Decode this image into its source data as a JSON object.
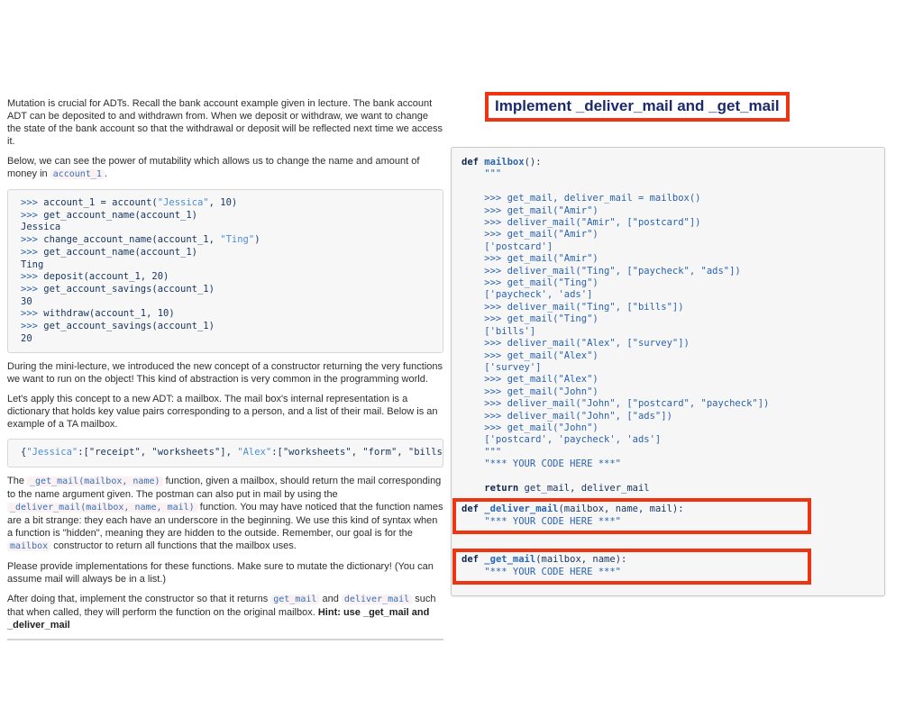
{
  "colors": {
    "highlight_red": "#ee3512",
    "title_navy": "#1b2a6b",
    "code_navy": "#16335f",
    "code_blue": "#2a62ad",
    "code_string_blue": "#4a8ed6",
    "inline_code_bg": "#fcf1f2",
    "panel_bg": "#f6f6f6"
  },
  "title_box": {
    "label": "Implement _deliver_mail and _get_mail"
  },
  "left_column": {
    "paragraphs": [
      {
        "name": "intro-mutation",
        "segments": [
          {
            "c": "t",
            "t": "Mutation is crucial for ADTs. Recall the bank account example given in lecture. The bank account ADT can be deposited to and withdrawn from. When we deposit or withdraw, we want to change the state of the bank account so that the withdrawal or deposit will be reflected next time we access it."
          }
        ]
      },
      {
        "name": "below-mutability",
        "segments": [
          {
            "c": "t",
            "t": "Below, we can see the power of mutability which allows us to change the name and amount of money in "
          },
          {
            "c": "c",
            "t": "account_1"
          },
          {
            "c": "t",
            "t": "."
          }
        ]
      },
      {
        "name": "mini-lecture",
        "segments": [
          {
            "c": "t",
            "t": "During the mini-lecture, we introduced the new concept of a constructor returning the very functions we want to run on the object! This kind of abstraction is very common in the programming world."
          }
        ]
      },
      {
        "name": "apply-concept",
        "segments": [
          {
            "c": "t",
            "t": "Let's apply this concept to a new ADT: a mailbox. The mail box's internal representation is a dictionary that holds key value pairs corresponding to a person, and a list of their mail. Below is an example of a TA mailbox."
          }
        ]
      },
      {
        "name": "get-mail-description",
        "segments": [
          {
            "c": "t",
            "t": "The "
          },
          {
            "c": "c",
            "t": "_get_mail(mailbox, name)"
          },
          {
            "c": "t",
            "t": " function, given a mailbox, should return the mail corresponding to the name argument given. The postman can also put in mail by using the "
          },
          {
            "c": "c",
            "t": "_deliver_mail(mailbox, name, mail)"
          },
          {
            "c": "t",
            "t": " function. You may have noticed that the function names are a bit strange: they each have an underscore in the beginning. We use this kind of syntax when a function is \"hidden\", meaning they are hidden to the outside. Remember, our goal is for the "
          },
          {
            "c": "c",
            "t": "mailbox"
          },
          {
            "c": "t",
            "t": " constructor to return all functions that the mailbox uses."
          }
        ]
      },
      {
        "name": "provide-implementations",
        "segments": [
          {
            "c": "t",
            "t": "Please provide implementations for these functions. Make sure to mutate the dictionary! (You can assume mail will always be in a list.)"
          }
        ]
      },
      {
        "name": "after-doing-that",
        "segments": [
          {
            "c": "t",
            "t": "After doing that, implement the constructor so that it returns "
          },
          {
            "c": "c",
            "t": "get_mail"
          },
          {
            "c": "t",
            "t": " and "
          },
          {
            "c": "c",
            "t": "deliver_mail"
          },
          {
            "c": "t",
            "t": " such that when called, they will perform the function on the original mailbox. "
          },
          {
            "c": "b",
            "t": "Hint: use _get_mail and _deliver_mail"
          }
        ]
      }
    ],
    "console_block": {
      "lines": [
        [
          {
            "c": "b",
            "t": ">>> "
          },
          {
            "c": "p",
            "t": "account_1 = account("
          },
          {
            "c": "s",
            "t": "\"Jessica\""
          },
          {
            "c": "p",
            "t": ", 10)"
          }
        ],
        [
          {
            "c": "b",
            "t": ">>> "
          },
          {
            "c": "p",
            "t": "get_account_name(account_1)"
          }
        ],
        [
          {
            "c": "p",
            "t": "Jessica"
          }
        ],
        [
          {
            "c": "b",
            "t": ">>> "
          },
          {
            "c": "p",
            "t": "change_account_name(account_1, "
          },
          {
            "c": "s",
            "t": "\"Ting\""
          },
          {
            "c": "p",
            "t": ")"
          }
        ],
        [
          {
            "c": "b",
            "t": ">>> "
          },
          {
            "c": "p",
            "t": "get_account_name(account_1)"
          }
        ],
        [
          {
            "c": "p",
            "t": "Ting"
          }
        ],
        [
          {
            "c": "b",
            "t": ">>> "
          },
          {
            "c": "p",
            "t": "deposit(account_1, 20)"
          }
        ],
        [
          {
            "c": "b",
            "t": ">>> "
          },
          {
            "c": "p",
            "t": "get_account_savings(account_1)"
          }
        ],
        [
          {
            "c": "p",
            "t": "30"
          }
        ],
        [
          {
            "c": "b",
            "t": ">>> "
          },
          {
            "c": "p",
            "t": "withdraw(account_1, 10)"
          }
        ],
        [
          {
            "c": "b",
            "t": ">>> "
          },
          {
            "c": "p",
            "t": "get_account_savings(account_1)"
          }
        ],
        [
          {
            "c": "p",
            "t": "20"
          }
        ]
      ]
    },
    "dict_block": {
      "lines": [
        [
          {
            "c": "p",
            "t": "{"
          },
          {
            "c": "s",
            "t": "\"Jessica\""
          },
          {
            "c": "p",
            "t": ":[\"receipt\", \"worksheets\"], "
          },
          {
            "c": "s",
            "t": "\"Alex\""
          },
          {
            "c": "p",
            "t": ":[\"worksheets\", \"form\", \"bills\"]}"
          }
        ]
      ]
    }
  },
  "right_panel": {
    "main_lines": [
      [
        {
          "c": "k",
          "t": "def "
        },
        {
          "c": "fn",
          "t": "mailbox"
        },
        {
          "c": "p",
          "t": "():"
        }
      ],
      [
        {
          "c": "b",
          "t": "    \"\"\""
        }
      ],
      [],
      [
        {
          "c": "b",
          "t": "    >>> get_mail, deliver_mail = mailbox()"
        }
      ],
      [
        {
          "c": "b",
          "t": "    >>> get_mail(\"Amir\")"
        }
      ],
      [
        {
          "c": "b",
          "t": "    >>> deliver_mail(\"Amir\", [\"postcard\"])"
        }
      ],
      [
        {
          "c": "b",
          "t": "    >>> get_mail(\"Amir\")"
        }
      ],
      [
        {
          "c": "b",
          "t": "    ['postcard']"
        }
      ],
      [
        {
          "c": "b",
          "t": "    >>> get_mail(\"Amir\")"
        }
      ],
      [
        {
          "c": "b",
          "t": "    >>> deliver_mail(\"Ting\", [\"paycheck\", \"ads\"])"
        }
      ],
      [
        {
          "c": "b",
          "t": "    >>> get_mail(\"Ting\")"
        }
      ],
      [
        {
          "c": "b",
          "t": "    ['paycheck', 'ads']"
        }
      ],
      [
        {
          "c": "b",
          "t": "    >>> deliver_mail(\"Ting\", [\"bills\"])"
        }
      ],
      [
        {
          "c": "b",
          "t": "    >>> get_mail(\"Ting\")"
        }
      ],
      [
        {
          "c": "b",
          "t": "    ['bills']"
        }
      ],
      [
        {
          "c": "b",
          "t": "    >>> deliver_mail(\"Alex\", [\"survey\"])"
        }
      ],
      [
        {
          "c": "b",
          "t": "    >>> get_mail(\"Alex\")"
        }
      ],
      [
        {
          "c": "b",
          "t": "    ['survey']"
        }
      ],
      [
        {
          "c": "b",
          "t": "    >>> get_mail(\"Alex\")"
        }
      ],
      [
        {
          "c": "b",
          "t": "    >>> get_mail(\"John\")"
        }
      ],
      [
        {
          "c": "b",
          "t": "    >>> deliver_mail(\"John\", [\"postcard\", \"paycheck\"])"
        }
      ],
      [
        {
          "c": "b",
          "t": "    >>> deliver_mail(\"John\", [\"ads\"])"
        }
      ],
      [
        {
          "c": "b",
          "t": "    >>> get_mail(\"John\")"
        }
      ],
      [
        {
          "c": "b",
          "t": "    ['postcard', 'paycheck', 'ads']"
        }
      ],
      [
        {
          "c": "b",
          "t": "    \"\"\""
        }
      ],
      [
        {
          "c": "b",
          "t": "    \"*** YOUR CODE HERE ***\""
        }
      ],
      [],
      [
        {
          "c": "k",
          "t": "    return "
        },
        {
          "c": "p",
          "t": "get_mail, deliver_mail"
        }
      ]
    ],
    "deliver_mail_box": {
      "lines": [
        [
          {
            "c": "k",
            "t": "def "
          },
          {
            "c": "fn",
            "t": "_deliver_mail"
          },
          {
            "c": "p",
            "t": "(mailbox, name, mail):"
          }
        ],
        [
          {
            "c": "b",
            "t": "    \"*** YOUR CODE HERE ***\""
          }
        ]
      ]
    },
    "get_mail_box": {
      "lines": [
        [
          {
            "c": "k",
            "t": "def "
          },
          {
            "c": "fn",
            "t": "_get_mail"
          },
          {
            "c": "p",
            "t": "(mailbox, name):"
          }
        ],
        [
          {
            "c": "b",
            "t": "    \"*** YOUR CODE HERE ***\""
          }
        ]
      ]
    }
  }
}
